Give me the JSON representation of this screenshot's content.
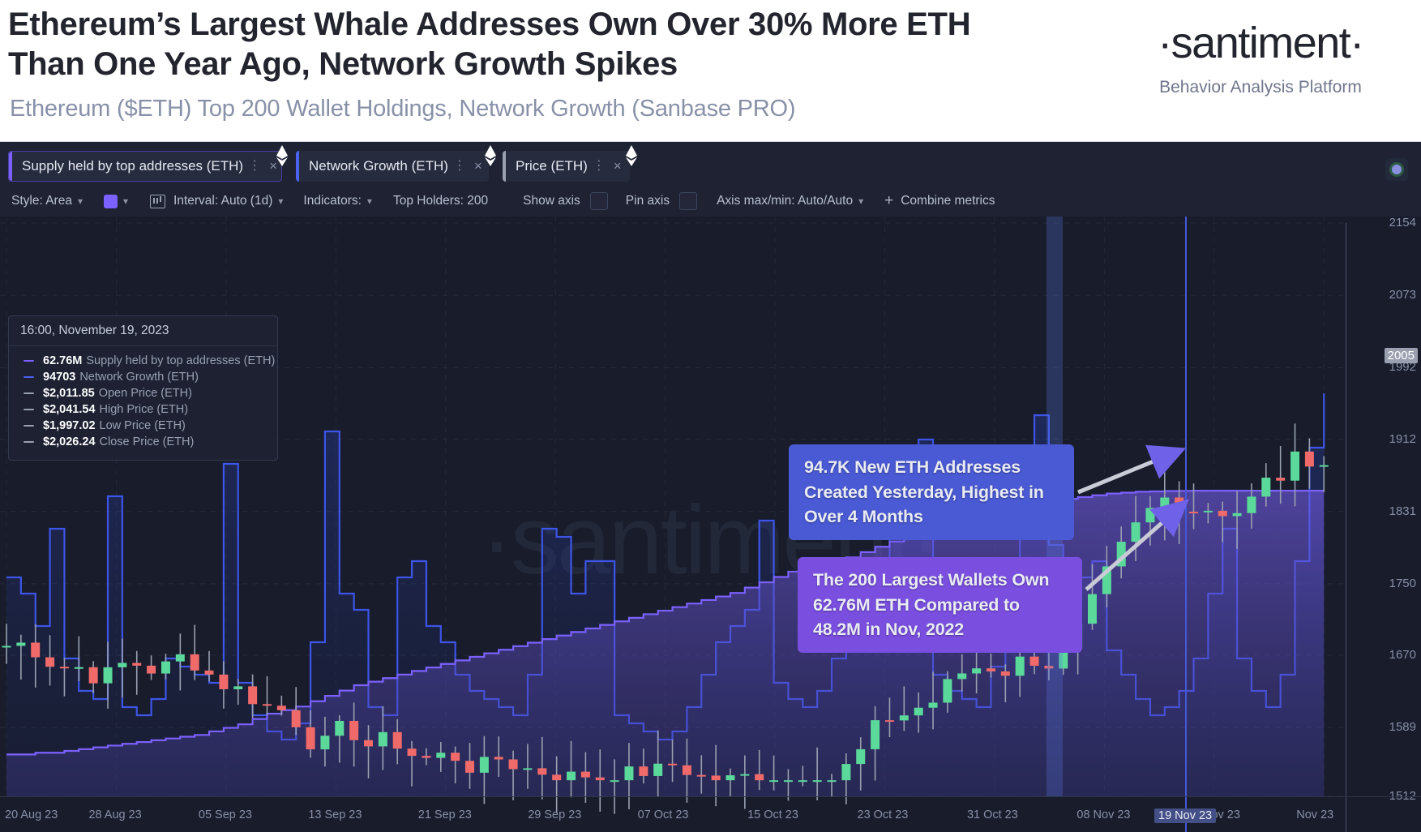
{
  "header": {
    "headline": "Ethereum’s Largest Whale Addresses Own Over 30% More ETH Than One Year Ago, Network Growth Spikes",
    "subheadline": "Ethereum ($ETH) Top 200 Wallet Holdings, Network Growth (Sanbase PRO)",
    "brand_name": "·santiment·",
    "brand_tagline": "Behavior Analysis Platform"
  },
  "tabs": [
    {
      "label": "Supply held by top addresses (ETH)",
      "accent": "#7b61ff",
      "active": true,
      "menu": "⋮",
      "close": "×",
      "asset_icon": "ethereum-icon"
    },
    {
      "label": "Network Growth (ETH)",
      "accent": "#4a63f0",
      "active": false,
      "menu": "⋮",
      "close": "×",
      "asset_icon": "ethereum-icon"
    },
    {
      "label": "Price (ETH)",
      "accent": "#9aa0b0",
      "active": false,
      "menu": "⋮",
      "close": "×",
      "asset_icon": "ethereum-icon"
    }
  ],
  "controls": {
    "style_label": "Style: Area",
    "color_swatch": "#7b61ff",
    "interval_label": "Interval: Auto (1d)",
    "indicators_label": "Indicators:",
    "top_holders_label": "Top Holders: 200",
    "show_axis_label": "Show axis",
    "pin_axis_label": "Pin axis",
    "axis_minmax_label": "Axis max/min: Auto/Auto",
    "combine_label": "Combine metrics",
    "plus": "+"
  },
  "tooltip": {
    "date": "16:00, November 19, 2023",
    "rows": [
      {
        "value": "62.76M",
        "name": "Supply held by top addresses (ETH)",
        "color": "#7b61ff"
      },
      {
        "value": "94703",
        "name": "Network Growth (ETH)",
        "color": "#4a63f0"
      },
      {
        "value": "$2,011.85",
        "name": "Open Price (ETH)",
        "color": "#9aa0b0"
      },
      {
        "value": "$2,041.54",
        "name": "High Price (ETH)",
        "color": "#9aa0b0"
      },
      {
        "value": "$1,997.02",
        "name": "Low Price (ETH)",
        "color": "#9aa0b0"
      },
      {
        "value": "$2,026.24",
        "name": "Close Price (ETH)",
        "color": "#9aa0b0"
      }
    ]
  },
  "annotations": [
    {
      "text": "94.7K New ETH Addresses Created Yesterday, Highest in Over 4 Months",
      "color": "#4a5ad4"
    },
    {
      "text": "The 200 Largest Wallets Own 62.76M ETH Compared to 48.2M in Nov, 2022",
      "color": "#7a4fe0"
    }
  ],
  "watermark": "·santiment·",
  "chart_data": {
    "type": "line",
    "title": "Ethereum ($ETH) Top 200 Wallet Holdings, Network Growth (Sanbase PRO)",
    "xlabel": "",
    "ylabel": "Price (ETH)",
    "grid": true,
    "legend_position": "top-left-tooltip",
    "y_axis": {
      "ticks": [
        2154,
        2073,
        1992,
        1912,
        1831,
        1750,
        1670,
        1589,
        1512
      ],
      "current_marker": 2005,
      "range": [
        1512,
        2154
      ]
    },
    "x_axis": {
      "ticks": [
        "20 Aug 23",
        "28 Aug 23",
        "05 Sep 23",
        "13 Sep 23",
        "21 Sep 23",
        "29 Sep 23",
        "07 Oct 23",
        "15 Oct 23",
        "23 Oct 23",
        "31 Oct 23",
        "08 Nov 23",
        "16 Nov 23",
        "Nov 23"
      ],
      "current_marker": "19 Nov 23"
    },
    "series": [
      {
        "name": "Supply held by top addresses (ETH)",
        "type": "area",
        "color": "#7b61ff",
        "latest_value": "62.76M",
        "values": [
          47.9,
          47.9,
          48.0,
          48.0,
          48.1,
          48.2,
          48.3,
          48.4,
          48.5,
          48.6,
          48.7,
          48.8,
          48.9,
          49.0,
          49.2,
          49.4,
          49.6,
          49.9,
          50.2,
          50.4,
          50.6,
          50.9,
          51.2,
          51.5,
          51.8,
          52.0,
          52.2,
          52.4,
          52.6,
          52.8,
          53.0,
          53.2,
          53.4,
          53.6,
          53.8,
          54.0,
          54.2,
          54.4,
          54.6,
          54.8,
          55.0,
          55.2,
          55.4,
          55.6,
          55.8,
          56.0,
          56.2,
          56.4,
          56.6,
          56.8,
          57.0,
          57.3,
          57.6,
          57.9,
          58.2,
          58.4,
          58.6,
          58.8,
          59.0,
          59.3,
          59.6,
          59.9,
          60.1,
          60.3,
          60.5,
          60.8,
          61.0,
          61.2,
          61.4,
          61.6,
          61.8,
          62.0,
          62.2,
          62.3,
          62.4,
          62.5,
          62.6,
          62.65,
          62.7,
          62.72,
          62.74,
          62.75,
          62.76,
          62.76,
          62.76,
          62.76,
          62.76,
          62.76,
          62.76,
          62.76,
          62.76,
          62.76
        ]
      },
      {
        "name": "Network Growth (ETH)",
        "type": "line",
        "color": "#3d55e8",
        "latest_value": "94703",
        "values": [
          72000,
          70000,
          66000,
          78000,
          62000,
          58000,
          57000,
          82000,
          56000,
          55000,
          57000,
          62000,
          61000,
          60000,
          59000,
          86000,
          59000,
          55000,
          53000,
          52000,
          54000,
          64000,
          90000,
          70000,
          68000,
          56000,
          55000,
          72000,
          74000,
          66000,
          64000,
          60000,
          58000,
          57000,
          56000,
          55000,
          60000,
          78000,
          77000,
          70000,
          74000,
          74000,
          55000,
          54000,
          53000,
          52000,
          53000,
          56000,
          60000,
          64000,
          66000,
          68000,
          79000,
          59000,
          57000,
          56000,
          58000,
          62000,
          66000,
          70000,
          74000,
          78000,
          80000,
          89000,
          60000,
          58000,
          57000,
          56000,
          61000,
          66000,
          88000,
          92000,
          76000,
          70000,
          72000,
          74000,
          63000,
          60000,
          57000,
          55000,
          56000,
          58000,
          62000,
          70000,
          78000,
          62000,
          58000,
          56000,
          60000,
          74000,
          88000,
          94703
        ]
      },
      {
        "name": "Price (ETH)",
        "type": "candlestick",
        "up_color": "#5ad99a",
        "down_color": "#f06a6a",
        "open": "$2,011.85",
        "high": "$2,041.54",
        "low": "$1,997.02",
        "close": "$2,026.24"
      }
    ]
  }
}
